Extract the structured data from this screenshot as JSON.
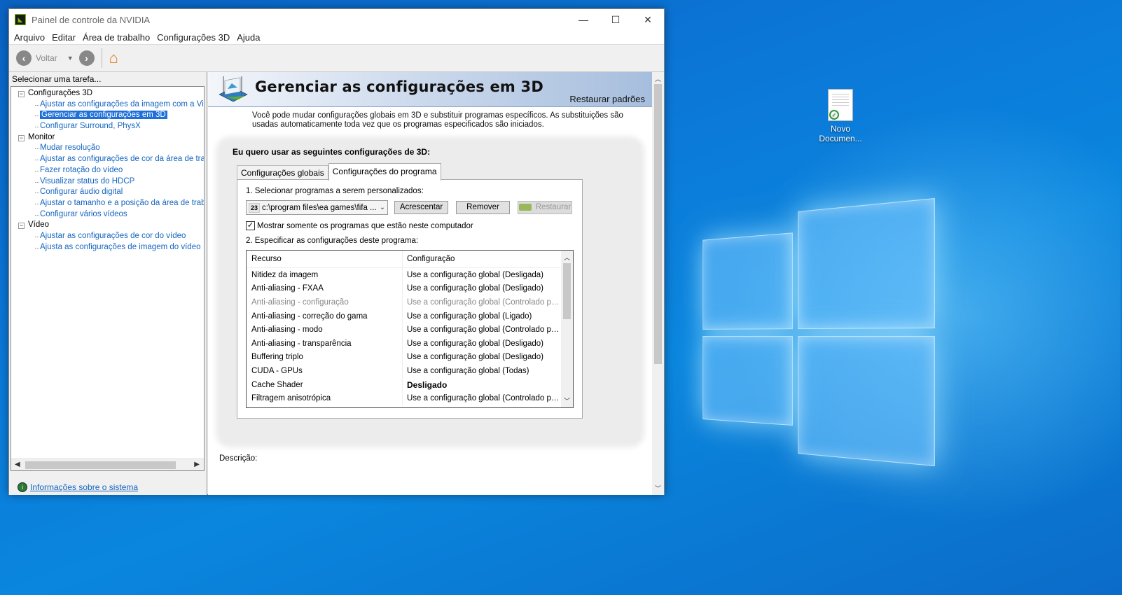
{
  "window": {
    "title": "Painel de controle da NVIDIA",
    "minimize": "—",
    "maximize": "☐",
    "close": "✕"
  },
  "menu": [
    "Arquivo",
    "Editar",
    "Área de trabalho",
    "Configurações 3D",
    "Ajuda"
  ],
  "toolbar": {
    "back_label": "Voltar"
  },
  "left": {
    "heading": "Selecionar uma tarefa...",
    "tree": [
      {
        "type": "cat",
        "label": "Configurações 3D"
      },
      {
        "type": "leaf",
        "label": "Ajustar as configurações da imagem com a Visualização",
        "selected": false
      },
      {
        "type": "leaf",
        "label": "Gerenciar as configurações em 3D",
        "selected": true
      },
      {
        "type": "leaf",
        "label": "Configurar Surround, PhysX",
        "selected": false
      },
      {
        "type": "cat",
        "label": "Monitor"
      },
      {
        "type": "leaf",
        "label": "Mudar resolução",
        "selected": false
      },
      {
        "type": "leaf",
        "label": "Ajustar as configurações de cor da área de trabalho",
        "selected": false
      },
      {
        "type": "leaf",
        "label": "Fazer rotação do vídeo",
        "selected": false
      },
      {
        "type": "leaf",
        "label": "Visualizar status do HDCP",
        "selected": false
      },
      {
        "type": "leaf",
        "label": "Configurar áudio digital",
        "selected": false
      },
      {
        "type": "leaf",
        "label": "Ajustar o tamanho e a posição da área de trabalho",
        "selected": false
      },
      {
        "type": "leaf",
        "label": "Configurar vários vídeos",
        "selected": false
      },
      {
        "type": "cat",
        "label": "Vídeo"
      },
      {
        "type": "leaf",
        "label": "Ajustar as configurações de cor do vídeo",
        "selected": false
      },
      {
        "type": "leaf",
        "label": "Ajusta as configurações de imagem do vídeo",
        "selected": false
      }
    ],
    "sysinfo_link": "Informações sobre o sistema"
  },
  "main": {
    "title": "Gerenciar as configurações em 3D",
    "restore_defaults": "Restaurar padrões",
    "intro": "Você pode mudar configurações globais em 3D e substituir programas específicos. As substituições são usadas automaticamente toda vez que os programas especificados são iniciados.",
    "question": "Eu quero usar as seguintes configurações de 3D:",
    "tabs": [
      {
        "label": "Configurações globais",
        "active": false
      },
      {
        "label": "Configurações do programa",
        "active": true
      }
    ],
    "step1": "1. Selecionar programas a serem personalizados:",
    "program_icon_text": "23",
    "program_value": "c:\\program files\\ea games\\fifa ...",
    "add_button": "Acrescentar",
    "remove_button": "Remover",
    "restore_button": "Restaurar",
    "checkbox_label": "Mostrar somente os programas que estão neste computador",
    "checkbox_checked": true,
    "step2": "2. Especificar as configurações deste programa:",
    "table": {
      "columns": [
        "Recurso",
        "Configuração"
      ],
      "rows": [
        {
          "feature": "Nitidez da imagem",
          "setting": "Use a configuração global (Desligada)",
          "dim": false,
          "bold": false
        },
        {
          "feature": "Anti-aliasing - FXAA",
          "setting": "Use a configuração global (Desligado)",
          "dim": false,
          "bold": false
        },
        {
          "feature": "Anti-aliasing - configuração",
          "setting": "Use a configuração global (Controlado por...",
          "dim": true,
          "bold": false
        },
        {
          "feature": "Anti-aliasing - correção do gama",
          "setting": "Use a configuração global (Ligado)",
          "dim": false,
          "bold": false
        },
        {
          "feature": "Anti-aliasing - modo",
          "setting": "Use a configuração global (Controlado por...",
          "dim": false,
          "bold": false
        },
        {
          "feature": "Anti-aliasing - transparência",
          "setting": "Use a configuração global (Desligado)",
          "dim": false,
          "bold": false
        },
        {
          "feature": "Buffering triplo",
          "setting": "Use a configuração global (Desligado)",
          "dim": false,
          "bold": false
        },
        {
          "feature": "CUDA - GPUs",
          "setting": "Use a configuração global (Todas)",
          "dim": false,
          "bold": false
        },
        {
          "feature": "Cache Shader",
          "setting": "Desligado",
          "dim": false,
          "bold": true
        },
        {
          "feature": "Filtragem anisotrópica",
          "setting": "Use a configuração global (Controlado por...",
          "dim": false,
          "bold": false
        }
      ]
    },
    "description_label": "Descrição:"
  },
  "desktop": {
    "icon_label_line1": "Novo",
    "icon_label_line2": "Documen..."
  },
  "colors": {
    "link": "#1565c0",
    "selection": "#1e6fd9",
    "nvidia_green": "#76b900",
    "desktop_blue": "#0b78d8"
  }
}
